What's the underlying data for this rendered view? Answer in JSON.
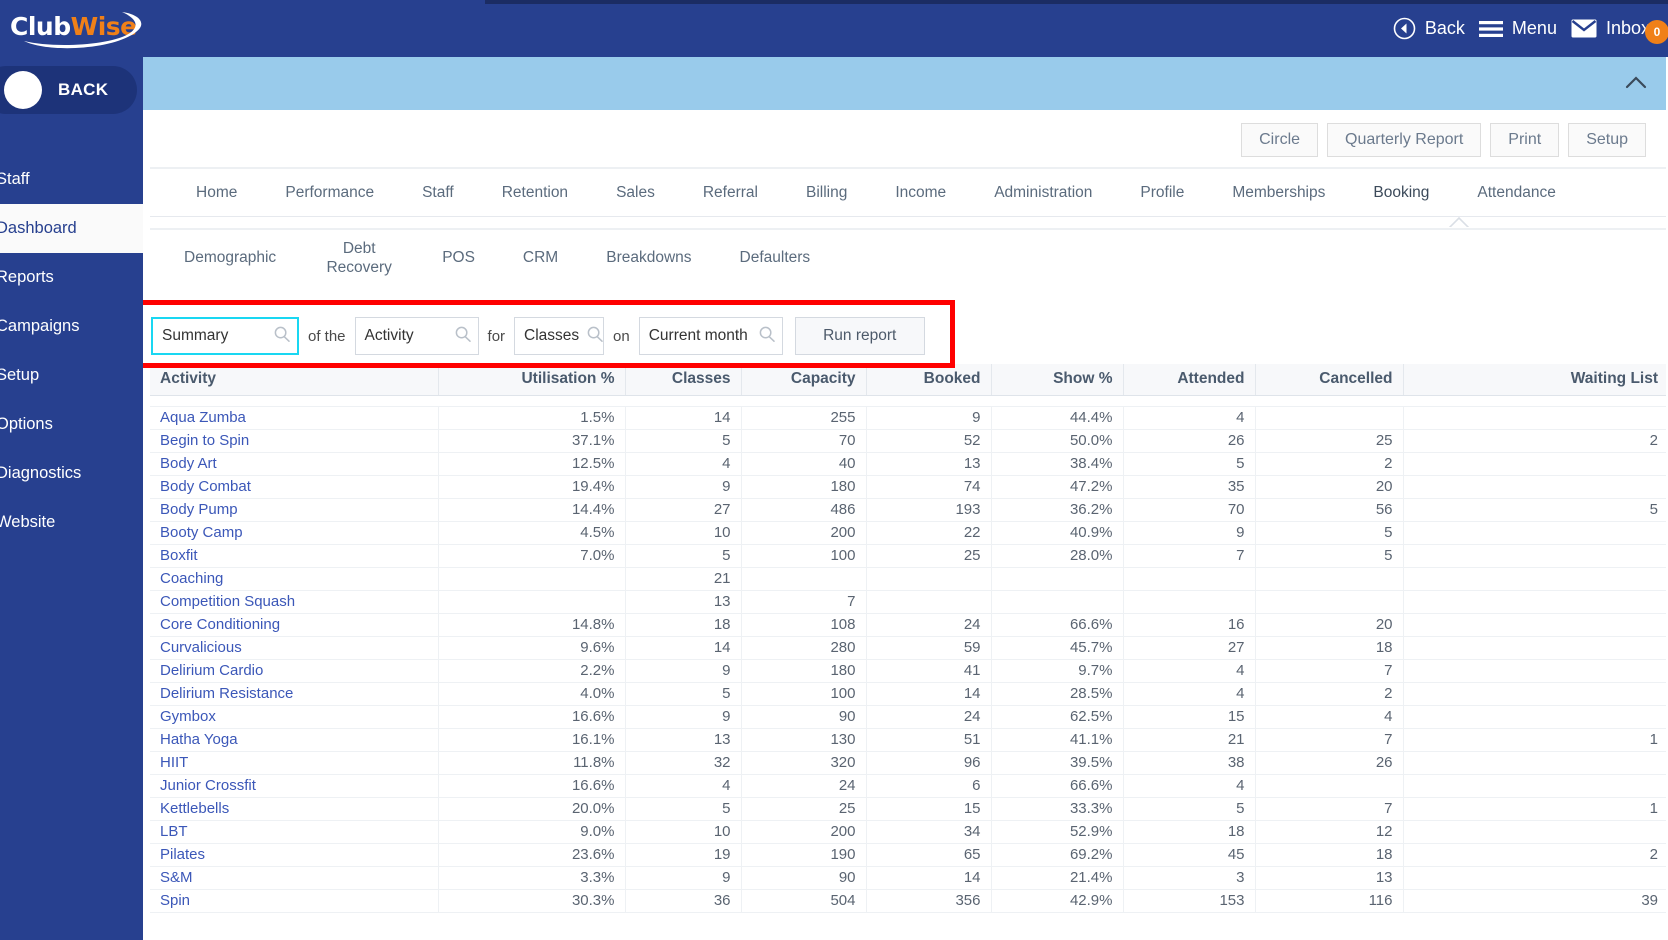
{
  "brand": {
    "name_part1": "Club",
    "name_part2": "Wise",
    "accent_color": "#f08018",
    "primary_color": "#27408f"
  },
  "sidebar": {
    "back_label": "BACK",
    "items": [
      {
        "label": "Staff",
        "active": false
      },
      {
        "label": "Dashboard",
        "active": true
      },
      {
        "label": "Reports",
        "active": false
      },
      {
        "label": "Campaigns",
        "active": false
      },
      {
        "label": "Setup",
        "active": false
      },
      {
        "label": "Options",
        "active": false
      },
      {
        "label": "Diagnostics",
        "active": false
      },
      {
        "label": "Website",
        "active": false
      }
    ]
  },
  "header": {
    "back_label": "Back",
    "menu_label": "Menu",
    "inbox_label": "Inbox",
    "inbox_count": "0"
  },
  "toolbar": {
    "circle_label": "Circle",
    "quarterly_report_label": "Quarterly Report",
    "print_label": "Print",
    "setup_label": "Setup",
    "active_underline_color": "#6aaf23"
  },
  "tabs": [
    {
      "label": "Home",
      "active": false
    },
    {
      "label": "Performance",
      "active": false
    },
    {
      "label": "Staff",
      "active": false
    },
    {
      "label": "Retention",
      "active": false
    },
    {
      "label": "Sales",
      "active": false
    },
    {
      "label": "Referral",
      "active": false
    },
    {
      "label": "Billing",
      "active": false
    },
    {
      "label": "Income",
      "active": false
    },
    {
      "label": "Administration",
      "active": false
    },
    {
      "label": "Profile",
      "active": false
    },
    {
      "label": "Memberships",
      "active": false
    },
    {
      "label": "Booking",
      "active": true
    },
    {
      "label": "Attendance",
      "active": false
    }
  ],
  "subtabs": [
    {
      "label": "Demographic"
    },
    {
      "label": "Debt Recovery"
    },
    {
      "label": "POS"
    },
    {
      "label": "CRM"
    },
    {
      "label": "Breakdowns"
    },
    {
      "label": "Defaulters"
    }
  ],
  "filter": {
    "report_type": "Summary",
    "conj_1": "of the",
    "subject": "Activity",
    "conj_2": "for",
    "scope": "Classes",
    "conj_3": "on",
    "period": "Current month",
    "run_label": "Run report",
    "highlight_color": "#ff0000",
    "focus_color": "#19d7f2"
  },
  "table": {
    "columns": [
      "Activity",
      "Utilisation %",
      "Classes",
      "Capacity",
      "Booked",
      "Show %",
      "Attended",
      "Cancelled",
      "Waiting List"
    ],
    "rows": [
      [
        "Aqua Zumba",
        "1.5%",
        "14",
        "255",
        "9",
        "44.4%",
        "4",
        "",
        ""
      ],
      [
        "Begin to Spin",
        "37.1%",
        "5",
        "70",
        "52",
        "50.0%",
        "26",
        "25",
        "2"
      ],
      [
        "Body Art",
        "12.5%",
        "4",
        "40",
        "13",
        "38.4%",
        "5",
        "2",
        ""
      ],
      [
        "Body Combat",
        "19.4%",
        "9",
        "180",
        "74",
        "47.2%",
        "35",
        "20",
        ""
      ],
      [
        "Body Pump",
        "14.4%",
        "27",
        "486",
        "193",
        "36.2%",
        "70",
        "56",
        "5"
      ],
      [
        "Booty Camp",
        "4.5%",
        "10",
        "200",
        "22",
        "40.9%",
        "9",
        "5",
        ""
      ],
      [
        "Boxfit",
        "7.0%",
        "5",
        "100",
        "25",
        "28.0%",
        "7",
        "5",
        ""
      ],
      [
        "Coaching",
        "",
        "21",
        "",
        "",
        "",
        "",
        "",
        ""
      ],
      [
        "Competition Squash",
        "",
        "13",
        "7",
        "",
        "",
        "",
        "",
        ""
      ],
      [
        "Core Conditioning",
        "14.8%",
        "18",
        "108",
        "24",
        "66.6%",
        "16",
        "20",
        ""
      ],
      [
        "Curvalicious",
        "9.6%",
        "14",
        "280",
        "59",
        "45.7%",
        "27",
        "18",
        ""
      ],
      [
        "Delirium Cardio",
        "2.2%",
        "9",
        "180",
        "41",
        "9.7%",
        "4",
        "7",
        ""
      ],
      [
        "Delirium Resistance",
        "4.0%",
        "5",
        "100",
        "14",
        "28.5%",
        "4",
        "2",
        ""
      ],
      [
        "Gymbox",
        "16.6%",
        "9",
        "90",
        "24",
        "62.5%",
        "15",
        "4",
        ""
      ],
      [
        "Hatha Yoga",
        "16.1%",
        "13",
        "130",
        "51",
        "41.1%",
        "21",
        "7",
        "1"
      ],
      [
        "HIIT",
        "11.8%",
        "32",
        "320",
        "96",
        "39.5%",
        "38",
        "26",
        ""
      ],
      [
        "Junior Crossfit",
        "16.6%",
        "4",
        "24",
        "6",
        "66.6%",
        "4",
        "",
        ""
      ],
      [
        "Kettlebells",
        "20.0%",
        "5",
        "25",
        "15",
        "33.3%",
        "5",
        "7",
        "1"
      ],
      [
        "LBT",
        "9.0%",
        "10",
        "200",
        "34",
        "52.9%",
        "18",
        "12",
        ""
      ],
      [
        "Pilates",
        "23.6%",
        "19",
        "190",
        "65",
        "69.2%",
        "45",
        "18",
        "2"
      ],
      [
        "S&M",
        "3.3%",
        "9",
        "90",
        "14",
        "21.4%",
        "3",
        "13",
        ""
      ],
      [
        "Spin",
        "30.3%",
        "36",
        "504",
        "356",
        "42.9%",
        "153",
        "116",
        "39"
      ]
    ]
  }
}
